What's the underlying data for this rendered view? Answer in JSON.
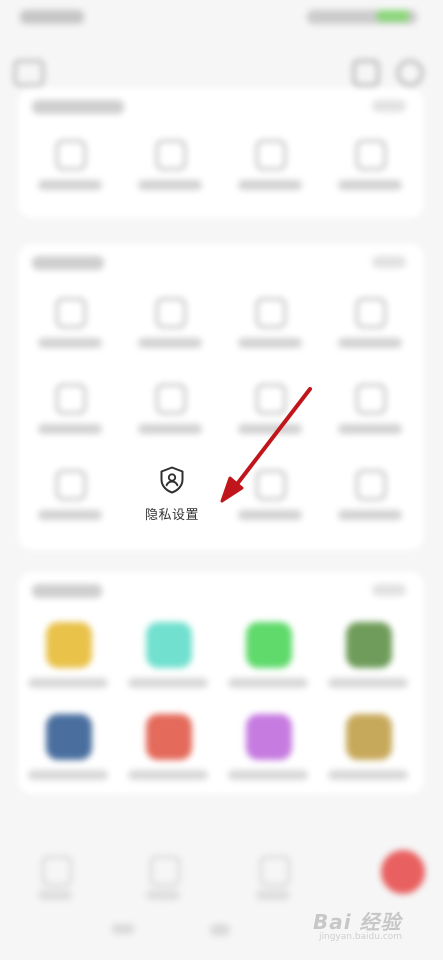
{
  "highlight": {
    "label": "隐私设置",
    "icon": "shield-user-icon"
  },
  "watermark": {
    "brand": "Bai 经验",
    "url": "jingyan.baidu.com"
  },
  "colors": {
    "arrow": "#c0161b",
    "card": "#ffffff",
    "background": "#f6f6f6"
  },
  "apps": [
    {
      "icon": "yellow-app-icon",
      "color": "#e9c24a"
    },
    {
      "icon": "teal-app-icon",
      "color": "#72e0cf"
    },
    {
      "icon": "green-app-icon",
      "color": "#5fda6b"
    },
    {
      "icon": "landscape-app-icon",
      "color": "#6f9c5a"
    },
    {
      "icon": "blue-app-icon",
      "color": "#4a6f9f"
    },
    {
      "icon": "red-app-icon",
      "color": "#e46a5b"
    },
    {
      "icon": "colorful-app-icon",
      "color": "#c67be0"
    },
    {
      "icon": "brown-app-icon",
      "color": "#c7a95b"
    }
  ]
}
